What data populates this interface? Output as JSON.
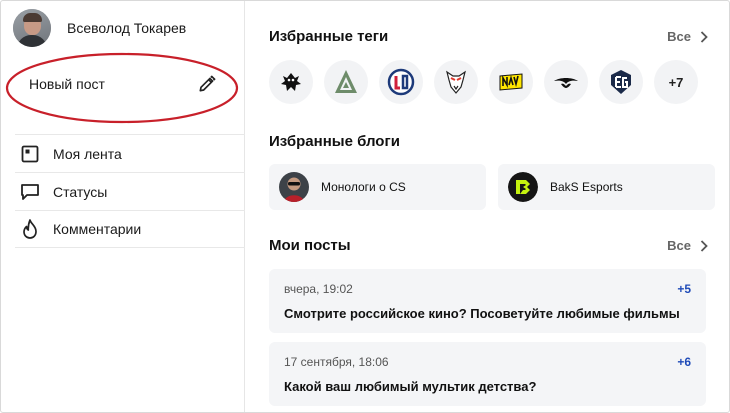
{
  "user": {
    "name": "Всеволод Токарев"
  },
  "new_post": {
    "label": "Новый пост"
  },
  "menu": [
    {
      "id": "feed",
      "label": "Моя лента",
      "icon": "square-icon"
    },
    {
      "id": "statuses",
      "label": "Статусы",
      "icon": "speech-bubble-icon"
    },
    {
      "id": "comments",
      "label": "Комментарии",
      "icon": "flame-icon"
    }
  ],
  "favorite_tags": {
    "title": "Избранные теги",
    "see_all": "Все",
    "icons": [
      "spider-logo-icon",
      "triangle-a-logo-icon",
      "liquid-logo-icon",
      "goat-logo-icon",
      "navi-logo-icon",
      "secret-logo-icon",
      "eg-logo-icon"
    ],
    "more": "+7"
  },
  "favorite_blogs": {
    "title": "Избранные блоги",
    "items": [
      {
        "name": "Монологи о CS",
        "icon": "person-avatar-icon"
      },
      {
        "name": "BakS Esports",
        "icon": "baks-logo-icon"
      }
    ]
  },
  "my_posts": {
    "title": "Мои посты",
    "see_all": "Все",
    "items": [
      {
        "date": "вчера, 19:02",
        "score": "+5",
        "title": "Смотрите российское кино? Посоветуйте любимые фильмы"
      },
      {
        "date": "17 сентября, 18:06",
        "score": "+6",
        "title": "Какой ваш любимый мультик детства?"
      }
    ]
  },
  "colors": {
    "accent_red": "#c8202a",
    "score_blue": "#1f4bb8",
    "card_bg": "#f4f5f7"
  }
}
